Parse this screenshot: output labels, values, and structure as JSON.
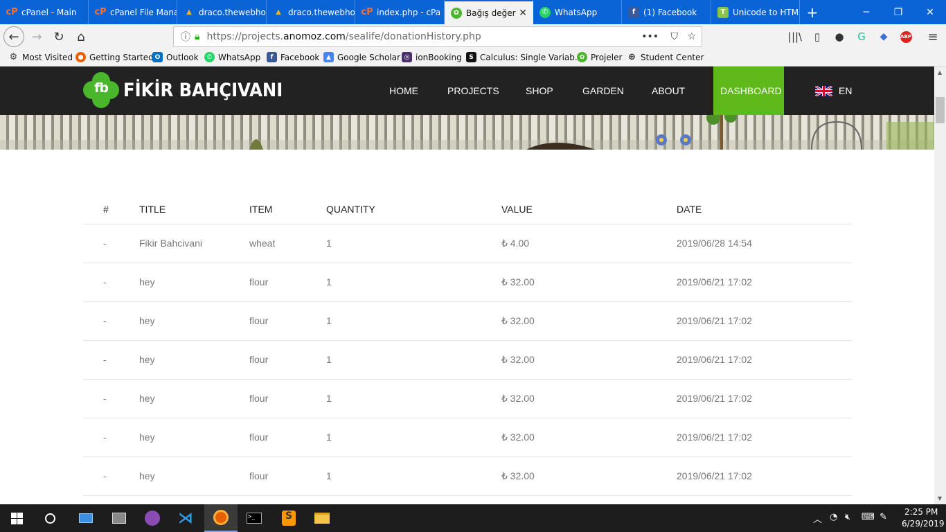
{
  "browser": {
    "tabs": [
      {
        "label": "cPanel - Main",
        "icon": "cpanel-icon"
      },
      {
        "label": "cPanel File Mana",
        "icon": "cpanel-icon"
      },
      {
        "label": "draco.thewebho",
        "icon": "draco-icon"
      },
      {
        "label": "draco.thewebho",
        "icon": "draco-icon"
      },
      {
        "label": "index.php - cPa",
        "icon": "cpanel-icon"
      },
      {
        "label": "Bağış değer",
        "icon": "gear-icon",
        "active": true
      },
      {
        "label": "WhatsApp",
        "icon": "whatsapp-icon"
      },
      {
        "label": "(1) Facebook",
        "icon": "facebook-icon"
      },
      {
        "label": "Unicode to HTM",
        "icon": "t-icon"
      }
    ],
    "url": {
      "prefix": "https://projects.",
      "host": "anomoz.com",
      "path": "/sealife/donationHistory.php"
    },
    "bookmarks": [
      {
        "label": "Most Visited",
        "icon": "gear-icon"
      },
      {
        "label": "Getting Started",
        "icon": "firefox-icon"
      },
      {
        "label": "Outlook",
        "icon": "outlook-icon"
      },
      {
        "label": "WhatsApp",
        "icon": "whatsapp-icon"
      },
      {
        "label": "Facebook",
        "icon": "facebook-icon"
      },
      {
        "label": "Google Scholar",
        "icon": "scholar-icon"
      },
      {
        "label": "ionBooking",
        "icon": "ion-icon"
      },
      {
        "label": "Calculus: Single Variab...",
        "icon": "s-icon"
      },
      {
        "label": "Projeler",
        "icon": "projeler-icon"
      },
      {
        "label": "Student Center",
        "icon": "globe-icon"
      }
    ],
    "colors": {
      "tabbar": "#0a64d6",
      "toolbar": "#f2f2f2"
    }
  },
  "site": {
    "logo_mark": "fb",
    "logo_text": "FİKİR BAHÇIVANI",
    "menu": [
      "HOME",
      "PROJECTS",
      "SHOP",
      "GARDEN",
      "ABOUT",
      "DASHBOARD"
    ],
    "lang": "EN",
    "colors": {
      "header": "#222222",
      "accent": "#5fb91a"
    }
  },
  "table": {
    "columns": [
      "#",
      "TITLE",
      "ITEM",
      "QUANTITY",
      "VALUE",
      "DATE"
    ],
    "rows": [
      [
        "-",
        "Fikir Bahcivani",
        "wheat",
        "1",
        "₺ 4.00",
        "2019/06/28 14:54"
      ],
      [
        "-",
        "hey",
        "flour",
        "1",
        "₺ 32.00",
        "2019/06/21 17:02"
      ],
      [
        "-",
        "hey",
        "flour",
        "1",
        "₺ 32.00",
        "2019/06/21 17:02"
      ],
      [
        "-",
        "hey",
        "flour",
        "1",
        "₺ 32.00",
        "2019/06/21 17:02"
      ],
      [
        "-",
        "hey",
        "flour",
        "1",
        "₺ 32.00",
        "2019/06/21 17:02"
      ],
      [
        "-",
        "hey",
        "flour",
        "1",
        "₺ 32.00",
        "2019/06/21 17:02"
      ],
      [
        "-",
        "hey",
        "flour",
        "1",
        "₺ 32.00",
        "2019/06/21 17:02"
      ]
    ]
  },
  "taskbar": {
    "time": "2:25 PM",
    "date": "6/29/2019"
  }
}
